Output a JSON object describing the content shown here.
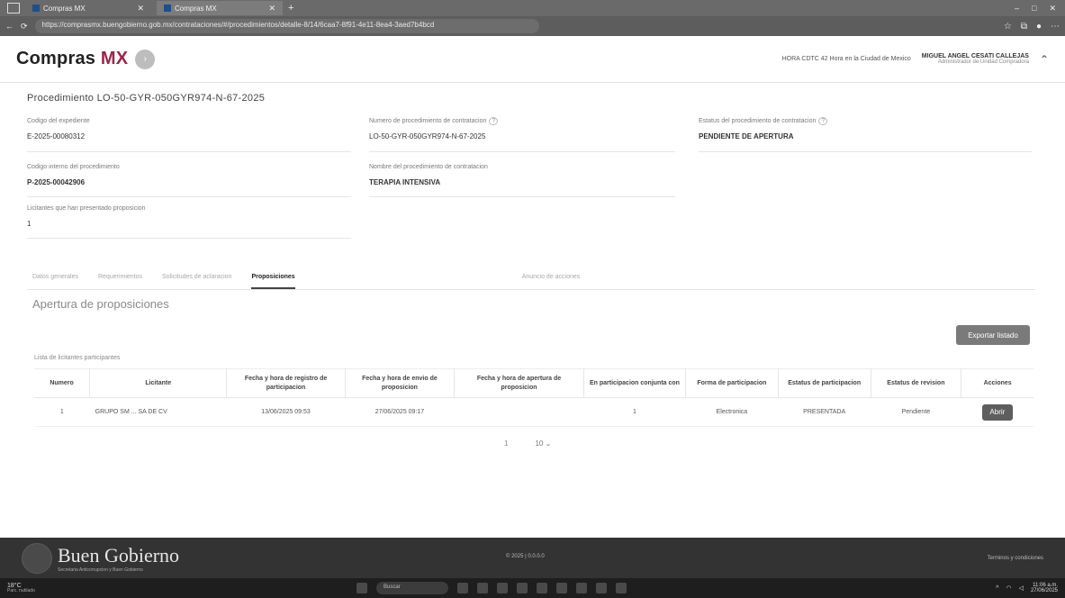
{
  "browser": {
    "tabs": [
      {
        "title": "Compras MX"
      },
      {
        "title": "Compras MX"
      }
    ],
    "new_tab": "+",
    "url": "https://comprasmx.buengobierno.gob.mx/contrataciones/#/procedimientos/detalle-8/14/6caa7-8f91-4e11-8ea4-3aed7b4bcd"
  },
  "header": {
    "logo_text": "Compras ",
    "logo_mx": "MX",
    "hora": "HORA CDTC 42 Hora en la Ciudad de Mexico",
    "user_name": "MIGUEL ANGEL CESATI CALLEJAS",
    "user_role": "Administrador de Unidad Compradora"
  },
  "procedure": {
    "title": "Procedimiento LO-50-GYR-050GYR974-N-67-2025",
    "fields": {
      "expediente": {
        "label": "Codigo del expediente",
        "value": "E-2025-00080312"
      },
      "numero": {
        "label": "Numero de procedimiento de contratacion",
        "value": "LO-50-GYR-050GYR974-N-67-2025"
      },
      "estatus": {
        "label": "Estatus del procedimiento de contratacion",
        "value": "PENDIENTE DE APERTURA"
      },
      "codigo_interno": {
        "label": "Codigo interno del procedimiento",
        "value": "P-2025-00042906"
      },
      "nombre": {
        "label": "Nombre del procedimiento de contratacion",
        "value": "TERAPIA INTENSIVA"
      },
      "licitantes": {
        "label": "Licitantes que han presentado proposicion",
        "value": "1"
      }
    }
  },
  "tabs": [
    "Datos generales",
    "Requerimientos",
    "Solicitudes de aclaracion",
    "Proposiciones",
    "Anuncio de acciones"
  ],
  "section_title": "Apertura de proposiciones",
  "export_label": "Exportar listado",
  "table": {
    "caption": "Lista de licitantes participantes",
    "headers": [
      "Numero",
      "Licitante",
      "Fecha y hora de registro de participacion",
      "Fecha y hora de envio de proposicion",
      "Fecha y hora de apertura de proposicion",
      "En participacion conjunta con",
      "Forma de participacion",
      "Estatus de participacion",
      "Estatus de revision",
      "Acciones"
    ],
    "rows": [
      {
        "numero": "1",
        "licitante": "GRUPO SM ... SA DE CV",
        "registro": "13/06/2025 09:53",
        "envio": "27/06/2025 09:17",
        "apertura": "",
        "conjunta": "1",
        "forma": "Electronica",
        "estatus_part": "PRESENTADA",
        "estatus_rev": "Pendiente",
        "accion": "Abrir"
      }
    ]
  },
  "pager": {
    "page": "1",
    "per_page": "10 ⌄"
  },
  "footer": {
    "brand": "Buen Gobierno",
    "brand_sub": "Secretaria Anticorrupcion y Buen Gobierno",
    "center": "© 2025 | 0.0.0.0",
    "right": "Terminos y condiciones"
  },
  "taskbar": {
    "weather_temp": "18°C",
    "weather_desc": "Parc. nublado",
    "search": "Buscar",
    "time": "11:06 a.m.",
    "date": "27/06/2025"
  }
}
